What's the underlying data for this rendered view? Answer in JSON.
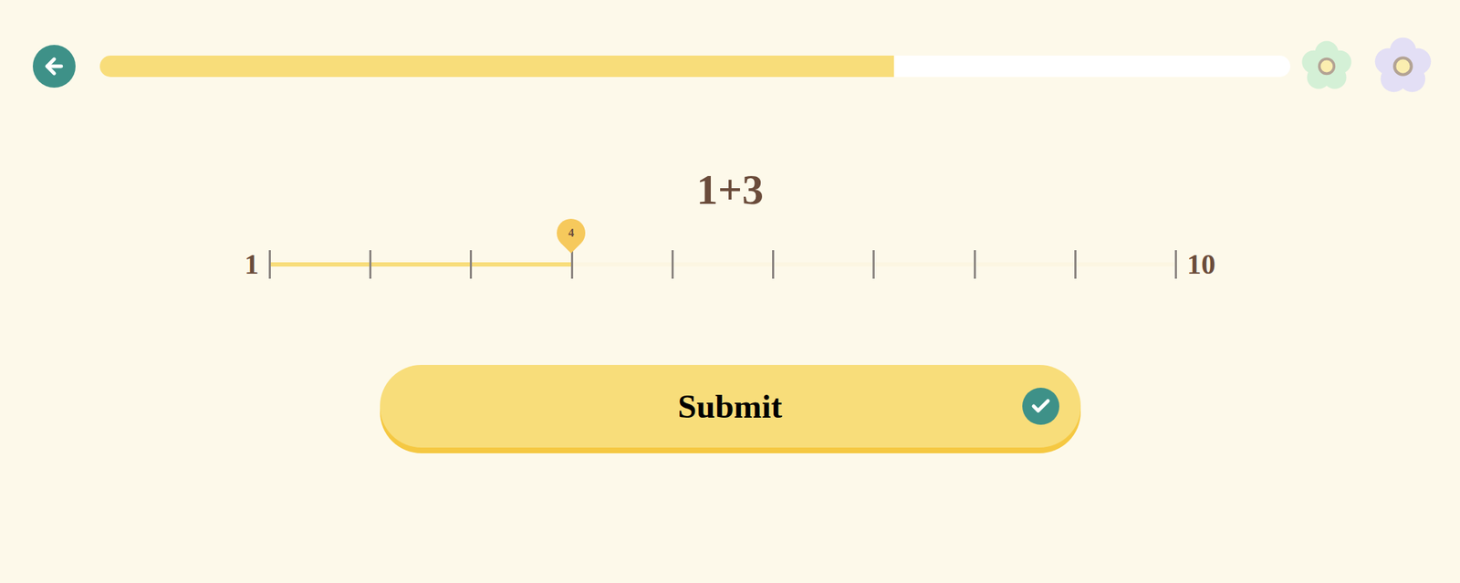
{
  "progress": {
    "level": 0.667
  },
  "rewards": [
    {
      "color": "#d4f0d6"
    },
    {
      "color": "#e3dff5"
    }
  ],
  "question": "1+3",
  "slider": {
    "min": "1",
    "max": "10",
    "value": "4",
    "level": 0.333
  },
  "submit": {
    "label": "Submit"
  }
}
